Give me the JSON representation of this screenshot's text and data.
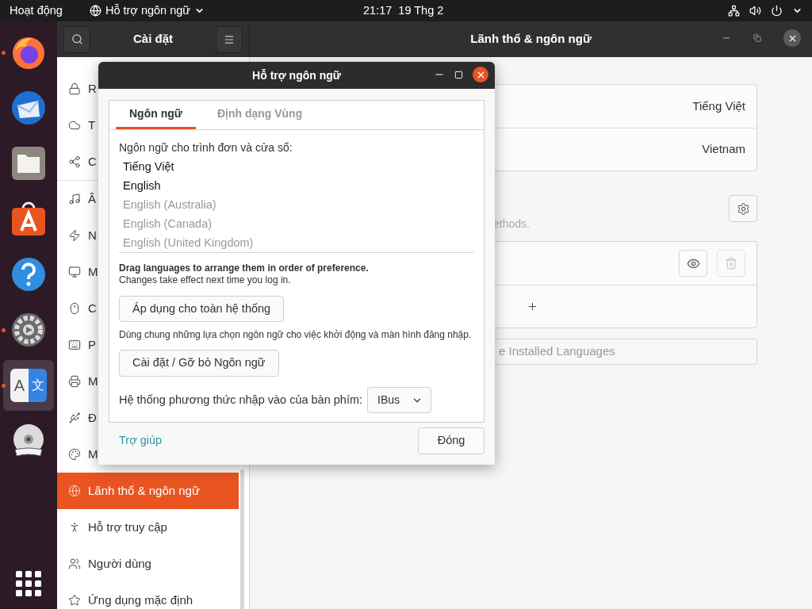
{
  "top_bar": {
    "activities": "Hoạt động",
    "app_menu": "Hỗ trợ ngôn ngữ",
    "clock": "21:17  19 Thg 2"
  },
  "dock": [
    {
      "kind": "firefox",
      "running": true,
      "selected": false
    },
    {
      "kind": "thunderbird",
      "running": false,
      "selected": false
    },
    {
      "kind": "files",
      "running": false,
      "selected": false
    },
    {
      "kind": "store",
      "running": false,
      "selected": false
    },
    {
      "kind": "help",
      "running": false,
      "selected": false
    },
    {
      "kind": "settings",
      "running": true,
      "selected": false
    },
    {
      "kind": "language",
      "running": true,
      "selected": true,
      "glyphs": [
        "A",
        "文"
      ]
    },
    {
      "kind": "dvd",
      "running": false,
      "selected": false
    }
  ],
  "settings": {
    "title": "Cài đặt",
    "page_title": "Lãnh thổ & ngôn ngữ",
    "sidebar": [
      {
        "label": "R",
        "selected": false
      },
      {
        "label": "T",
        "selected": false
      },
      {
        "label": "C",
        "selected": false,
        "divider_after": true
      },
      {
        "label": "Â",
        "selected": false
      },
      {
        "label": "N",
        "selected": false
      },
      {
        "label": "M",
        "selected": false
      },
      {
        "label": "C",
        "selected": false
      },
      {
        "label": "P",
        "selected": false
      },
      {
        "label": "M",
        "selected": false
      },
      {
        "label": "Đ",
        "selected": false
      },
      {
        "label": "M",
        "selected": false
      },
      {
        "label": "Lãnh thổ & ngôn ngữ",
        "selected": true
      },
      {
        "label": "Hỗ trợ truy cập",
        "selected": false
      },
      {
        "label": "Người dùng",
        "selected": false
      },
      {
        "label": "Ứng dụng mặc định",
        "selected": false
      }
    ],
    "language_rows": [
      "Tiếng Việt",
      "Vietnam"
    ],
    "input_hint": "ethods.",
    "manage_button": "e Installed Languages"
  },
  "dialog": {
    "title": "Hỗ trợ ngôn ngữ",
    "tabs": [
      {
        "label": "Ngôn ngữ",
        "selected": true
      },
      {
        "label": "Định dạng Vùng",
        "selected": false
      }
    ],
    "list_label": "Ngôn ngữ cho trình đơn và cửa sổ:",
    "languages": [
      {
        "name": "Tiếng Việt",
        "dimmed": false
      },
      {
        "name": "English",
        "dimmed": false
      },
      {
        "name": "English (Australia)",
        "dimmed": true
      },
      {
        "name": "English (Canada)",
        "dimmed": true
      },
      {
        "name": "English (United Kingdom)",
        "dimmed": true
      }
    ],
    "drag_hint": "Drag languages to arrange them in order of preference.",
    "change_note": "Changes take effect next time you log in.",
    "apply_button": "Áp dụng cho toàn hệ thống",
    "apply_note": "Dùng chung những lựa chọn ngôn ngữ cho việc khởi động và màn hình đăng nhập.",
    "install_button": "Cài đặt / Gỡ bỏ Ngôn ngữ",
    "input_label": "Hệ thống phương thức nhập vào của bàn phím:",
    "input_value": "IBus",
    "help_link": "Trợ giúp",
    "close_button": "Đóng"
  }
}
